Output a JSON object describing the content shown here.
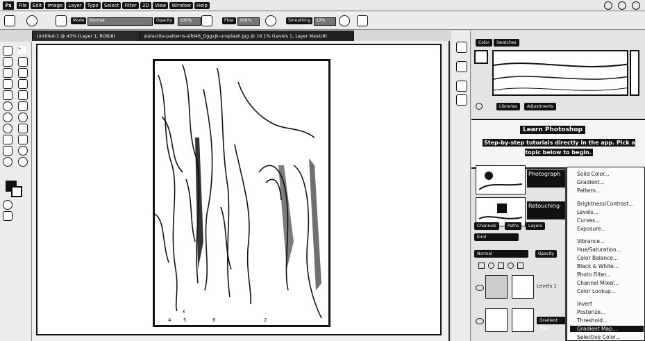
{
  "menubar": {
    "app_logo": "Ps",
    "items": [
      "File",
      "Edit",
      "Image",
      "Layer",
      "Type",
      "Select",
      "Filter",
      "3D",
      "View",
      "Window",
      "Help"
    ]
  },
  "optionsbar": {
    "mode_label": "Mode",
    "mode_value": "Normal",
    "opacity_label": "Opacity",
    "opacity_value": "100%",
    "flow_label": "Flow",
    "flow_value": "100%",
    "smoothing_label": "Smoothing",
    "smoothing_value": "10%"
  },
  "tabs": [
    {
      "label": "Untitled-1 @ 43% (Layer 1, RGB/8)"
    },
    {
      "label": "stalactite-patterns-slfd46_Dggxjk-unsplash.jpg @ 16.1% (Levels 1, Layer Mask/8)"
    }
  ],
  "canvas": {
    "scrap_text": [
      "3",
      "4",
      "5",
      "6",
      "2"
    ]
  },
  "panel": {
    "color_tab": "Color",
    "swatches_tab": "Swatches",
    "libraries_tab": "Libraries",
    "adjustments_tab": "Adjustments",
    "learn": {
      "title": "Learn Photoshop",
      "description": "Step-by-step tutorials directly in the app. Pick a topic below to begin."
    },
    "tutorials": [
      {
        "label": "Photograph"
      },
      {
        "label": "Retouching"
      }
    ],
    "layers_tabs": [
      "Channels",
      "Paths",
      "Layers"
    ],
    "layers_kind": "Kind",
    "layers_opacity_label": "Opacity",
    "layers_blend": "Normal",
    "layers": [
      {
        "name": "Levels 1"
      },
      {
        "name": "Gradient Map"
      }
    ]
  },
  "context_menu": {
    "items": [
      "Solid Color...",
      "Gradient...",
      "Pattern...",
      "Brightness/Contrast...",
      "Levels...",
      "Curves...",
      "Exposure...",
      "Vibrance...",
      "Hue/Saturation...",
      "Color Balance...",
      "Black & White...",
      "Photo Filter...",
      "Channel Mixer...",
      "Color Lookup...",
      "Invert",
      "Posterize...",
      "Threshold...",
      "Gradient Map...",
      "Selective Color..."
    ],
    "highlighted": "Gradient Map..."
  }
}
